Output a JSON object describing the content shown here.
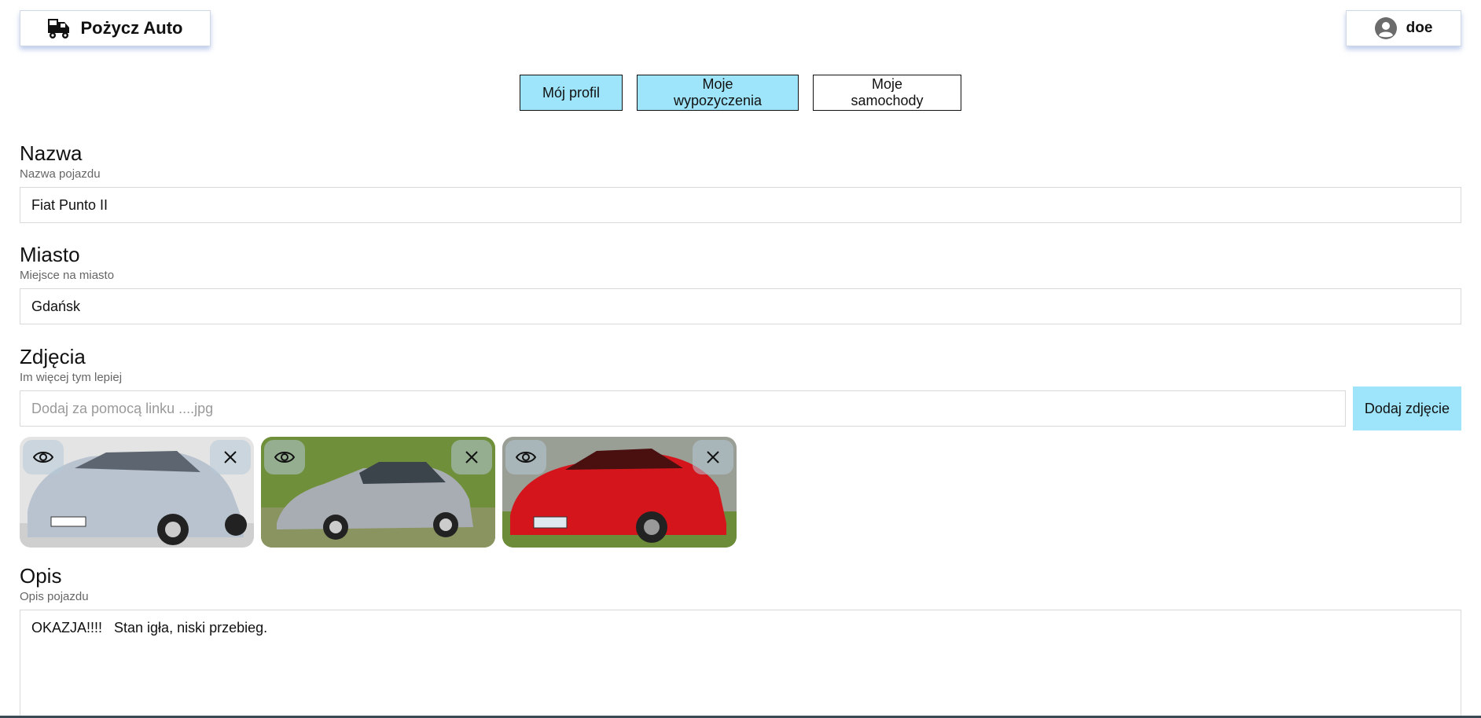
{
  "header": {
    "brand": "Pożycz Auto",
    "brand_icon": "truck-icon",
    "user_name": "doe",
    "user_icon": "user-avatar-icon"
  },
  "tabs": [
    {
      "label": "Mój profil",
      "active": true
    },
    {
      "label": "Moje wypozyczenia",
      "active": true
    },
    {
      "label": "Moje samochody",
      "active": false
    }
  ],
  "form": {
    "name": {
      "title": "Nazwa",
      "hint": "Nazwa pojazdu",
      "value": "Fiat Punto II"
    },
    "city": {
      "title": "Miasto",
      "hint": "Miejsce na miasto",
      "value": "Gdańsk"
    },
    "photos": {
      "title": "Zdjęcia",
      "hint": "Im więcej tym lepiej",
      "placeholder": "Dodaj za pomocą linku ....jpg",
      "add_label": "Dodaj zdjęcie",
      "items": [
        {
          "car_color": "#b9c3cf",
          "bg": "#e6e6e6"
        },
        {
          "car_color": "#a8adb3",
          "bg": "#6f8f3a"
        },
        {
          "car_color": "#d4161c",
          "bg": "#9a9f96"
        }
      ]
    },
    "description": {
      "title": "Opis",
      "hint": "Opis pojazdu",
      "value": "OKAZJA!!!!   Stan igła, niski przebieg."
    }
  },
  "colors": {
    "accent": "#9ee5fb",
    "shadow": "#466ec8"
  }
}
